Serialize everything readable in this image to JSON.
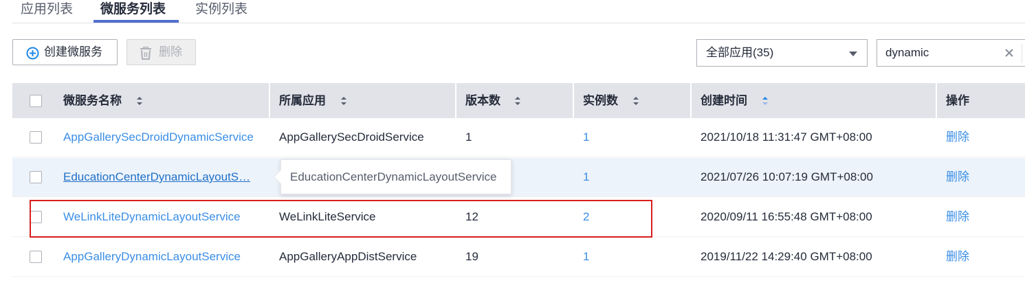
{
  "tabs": [
    {
      "label": "应用列表",
      "active": false
    },
    {
      "label": "微服务列表",
      "active": true
    },
    {
      "label": "实例列表",
      "active": false
    }
  ],
  "toolbar": {
    "create_label": "创建微服务",
    "delete_label": "删除",
    "filter_value": "全部应用(35)",
    "search_value": "dynamic"
  },
  "table": {
    "columns": [
      "微服务名称",
      "所属应用",
      "版本数",
      "实例数",
      "创建时间",
      "操作"
    ],
    "rows": [
      {
        "name": "AppGallerySecDroidDynamicService",
        "app": "AppGallerySecDroidService",
        "versions": "1",
        "instances": "1",
        "created": "2021/10/18 11:31:47 GMT+08:00",
        "action": "删除"
      },
      {
        "name": "EducationCenterDynamicLayoutS…",
        "app": "",
        "versions": "",
        "instances": "1",
        "created": "2021/07/26 10:07:19 GMT+08:00",
        "action": "删除"
      },
      {
        "name": "WeLinkLiteDynamicLayoutService",
        "app": "WeLinkLiteService",
        "versions": "12",
        "instances": "2",
        "created": "2020/09/11 16:55:48 GMT+08:00",
        "action": "删除"
      },
      {
        "name": "AppGalleryDynamicLayoutService",
        "app": "AppGalleryAppDistService",
        "versions": "19",
        "instances": "1",
        "created": "2019/11/22 14:29:40 GMT+08:00",
        "action": "删除"
      }
    ]
  },
  "tooltip": {
    "text": "EducationCenterDynamicLayoutService"
  },
  "colors": {
    "accent": "#526ecc",
    "link": "#3a8ee6",
    "header_bg": "#e1e3e8",
    "highlight": "#d81e1e",
    "hover_row": "#edf3fa"
  }
}
